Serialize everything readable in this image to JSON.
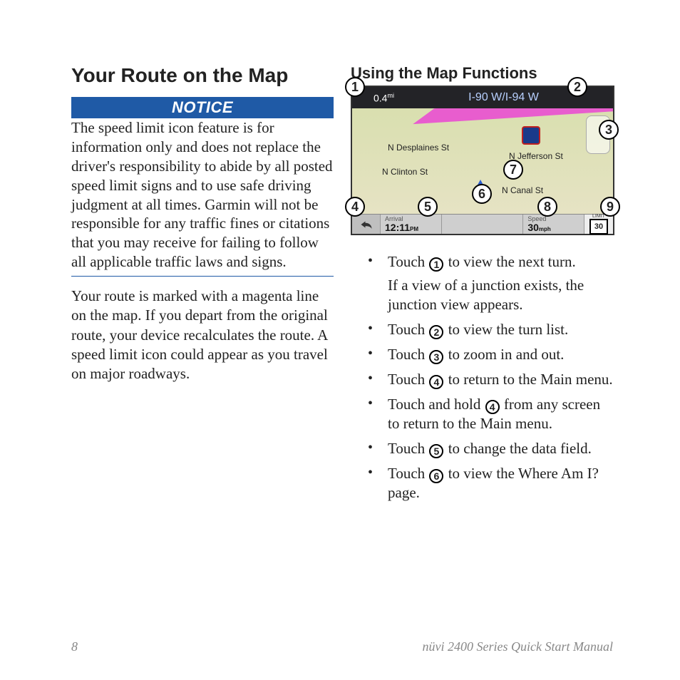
{
  "title": "Your Route on the Map",
  "notice_label": "NOTICE",
  "notice_text": "The speed limit icon feature is for information only and does not replace the driver's responsibility to abide by all posted speed limit signs and to use safe driving judgment at all times. Garmin will not be responsible for any traffic fines or citations that you may receive for failing to follow all applicable traffic laws and signs.",
  "body_text": "Your route is marked with a magenta line on the map. If you depart from the original route, your device recalculates the route. A speed limit icon could appear as you travel on major roadways.",
  "subtitle": "Using the Map Functions",
  "gps": {
    "distance": "0.4",
    "distance_unit": "mi",
    "road": "I-90 W/I-94 W",
    "streets": {
      "desplaines": "N Desplaines St",
      "clinton": "N Clinton St",
      "jefferson": "N Jefferson St",
      "canal": "N Canal St"
    },
    "arrival_label": "Arrival",
    "arrival_value": "12:11",
    "arrival_ampm": "PM",
    "speed_label": "Speed",
    "speed_value": "30",
    "speed_unit": "mph",
    "limit_label": "LIMIT",
    "limit_value": "30"
  },
  "callouts": [
    "1",
    "2",
    "3",
    "4",
    "5",
    "6",
    "7",
    "8",
    "9"
  ],
  "items": [
    {
      "pre": "Touch ",
      "num": "1",
      "post": " to view the next turn.",
      "sub": "If a view of a junction exists, the junction view appears."
    },
    {
      "pre": "Touch ",
      "num": "2",
      "post": " to view the turn list."
    },
    {
      "pre": "Touch ",
      "num": "3",
      "post": " to zoom in and out."
    },
    {
      "pre": "Touch ",
      "num": "4",
      "post": " to return to the Main menu."
    },
    {
      "pre": "Touch and hold ",
      "num": "4",
      "post": " from any screen to return to the Main menu."
    },
    {
      "pre": "Touch ",
      "num": "5",
      "post": " to change the data field."
    },
    {
      "pre": "Touch ",
      "num": "6",
      "post": " to view the Where Am I? page."
    }
  ],
  "footer": {
    "page": "8",
    "product": "nüvi 2400 Series Quick Start Manual"
  }
}
